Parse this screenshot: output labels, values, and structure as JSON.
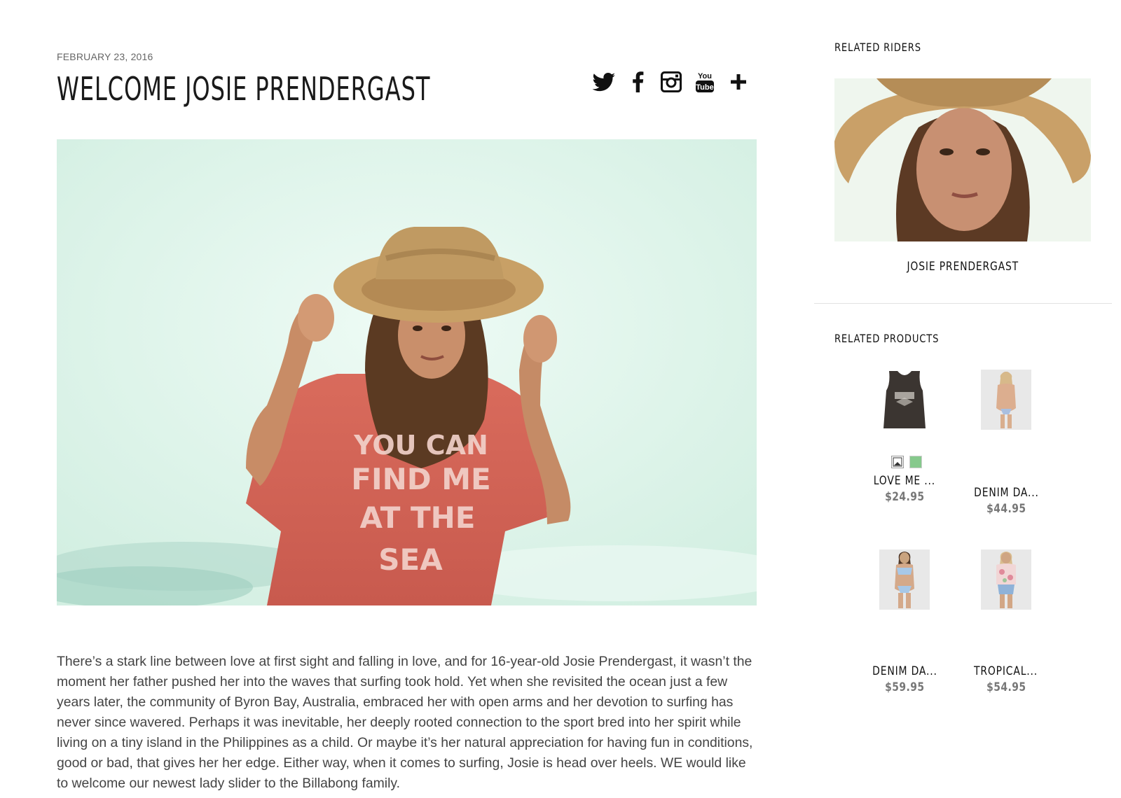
{
  "article": {
    "date": "FEBRUARY 23, 2016",
    "title": "WELCOME JOSIE PRENDERGAST",
    "body": "There’s a stark line between love at first sight and falling in love, and for 16-year-old Josie Prendergast, it wasn’t the moment her father pushed her into the waves that surfing took hold. Yet when she revisited the ocean just a few years later, the community of Byron Bay, Australia, embraced her with open arms and her devotion to surfing has never since wavered. Perhaps it was inevitable, her deeply rooted connection to the sport bred into her spirit while living on a tiny island in the Philippines as a child. Or maybe it’s her natural appreciation for having fun in conditions, good or bad, that gives her her edge. Either way, when it comes to surfing, Josie is head over heels. WE would like to welcome our newest lady slider to the Billabong family.",
    "hero_shirt_text": [
      "YOU CAN",
      "FIND ME",
      "AT THE",
      "SEA"
    ]
  },
  "social": {
    "icons": [
      "twitter-icon",
      "facebook-icon",
      "instagram-icon",
      "youtube-icon",
      "plus-icon"
    ],
    "youtube_text_top": "You",
    "youtube_text_bottom": "Tube"
  },
  "sidebar": {
    "related_riders_heading": "RELATED RIDERS",
    "rider_name": "JOSIE PRENDERGAST",
    "related_products_heading": "RELATED PRODUCTS",
    "products": [
      {
        "name": "LOVE ME ...",
        "price": "$24.95",
        "swatches": [
          "#ffffff",
          "#86c98c"
        ]
      },
      {
        "name": "DENIM DA...",
        "price": "$44.95"
      },
      {
        "name": "DENIM DA...",
        "price": "$59.95"
      },
      {
        "name": "TROPICAL...",
        "price": "$54.95"
      }
    ]
  },
  "colors": {
    "hero_bg": "#dbf4e9",
    "shirt": "#d9695a",
    "hat": "#c9a46a"
  }
}
